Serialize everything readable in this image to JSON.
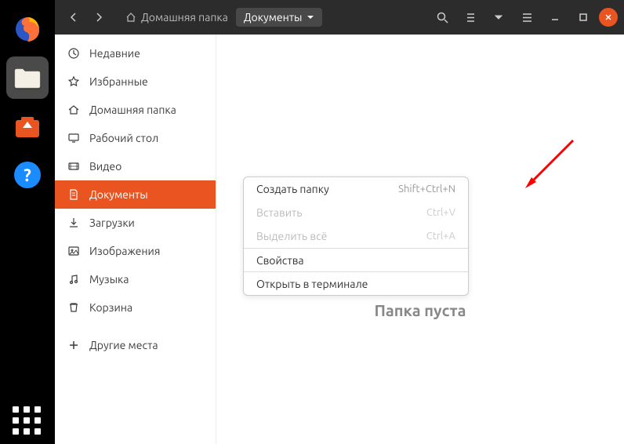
{
  "dock": {
    "items": [
      {
        "name": "firefox"
      },
      {
        "name": "files",
        "active": true
      },
      {
        "name": "software"
      },
      {
        "name": "help"
      }
    ]
  },
  "titlebar": {
    "breadcrumb_home": "Домашняя папка",
    "breadcrumb_current": "Документы"
  },
  "sidebar": {
    "items": [
      {
        "label": "Недавние",
        "icon": "clock-icon"
      },
      {
        "label": "Избранные",
        "icon": "star-icon"
      },
      {
        "label": "Домашняя папка",
        "icon": "home-icon"
      },
      {
        "label": "Рабочий стол",
        "icon": "desktop-icon"
      },
      {
        "label": "Видео",
        "icon": "video-icon"
      },
      {
        "label": "Документы",
        "icon": "document-icon",
        "active": true
      },
      {
        "label": "Загрузки",
        "icon": "download-icon"
      },
      {
        "label": "Изображения",
        "icon": "image-icon"
      },
      {
        "label": "Музыка",
        "icon": "music-icon"
      },
      {
        "label": "Корзина",
        "icon": "trash-icon"
      },
      {
        "label": "Другие места",
        "icon": "plus-icon"
      }
    ]
  },
  "context_menu": {
    "items": [
      {
        "label": "Создать папку",
        "shortcut": "Shift+Ctrl+N",
        "disabled": false
      },
      {
        "label": "Вставить",
        "shortcut": "Ctrl+V",
        "disabled": true
      },
      {
        "label": "Выделить всё",
        "shortcut": "Ctrl+A",
        "disabled": true
      },
      {
        "label": "Свойства",
        "shortcut": "",
        "disabled": false
      },
      {
        "label": "Открыть в терминале",
        "shortcut": "",
        "disabled": false
      }
    ]
  },
  "content": {
    "empty_text": "Папка пуста"
  }
}
